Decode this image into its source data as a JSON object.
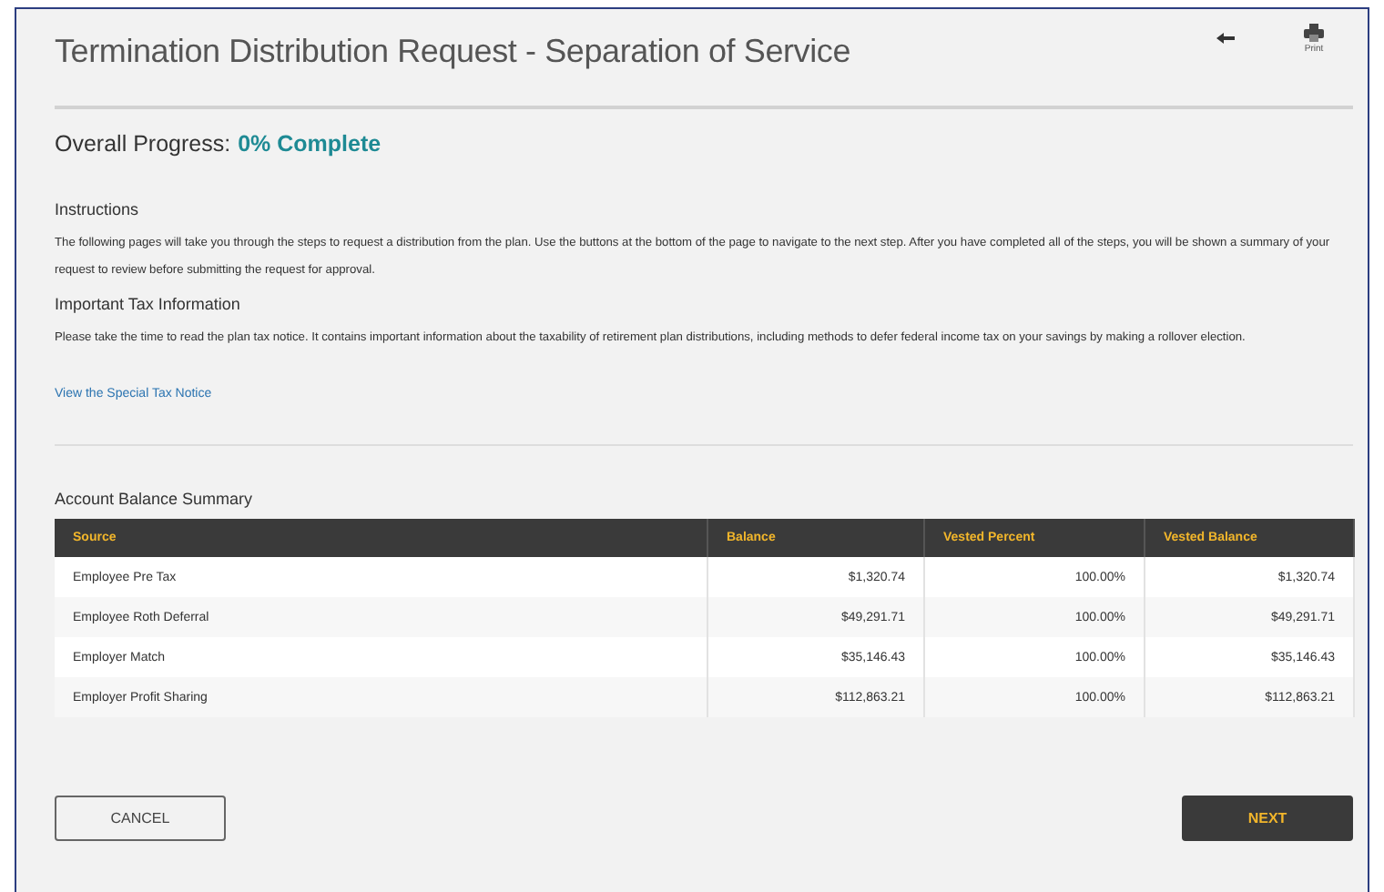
{
  "page": {
    "title": "Termination Distribution Request - Separation of Service",
    "print_label": "Print"
  },
  "progress": {
    "label": "Overall Progress:",
    "value": "0% Complete"
  },
  "instructions": {
    "heading": "Instructions",
    "text": "The following pages will take you through the steps to request a distribution from the plan. Use the buttons at the bottom of the page to navigate to the next step. After you have completed all of the steps, you will be shown a summary of your request to review before submitting the request for approval."
  },
  "tax_info": {
    "heading": "Important Tax Information",
    "text": "Please take the time to read the plan tax notice. It contains important information about the taxability of retirement plan distributions, including methods to defer federal income tax on your savings by making a rollover election.",
    "link": "View the Special Tax Notice"
  },
  "table": {
    "title": "Account Balance Summary",
    "columns": [
      "Source",
      "Balance",
      "Vested Percent",
      "Vested Balance"
    ],
    "rows": [
      [
        "Employee Pre Tax",
        "$1,320.74",
        "100.00%",
        "$1,320.74"
      ],
      [
        "Employee Roth Deferral",
        "$49,291.71",
        "100.00%",
        "$49,291.71"
      ],
      [
        "Employer Match",
        "$35,146.43",
        "100.00%",
        "$35,146.43"
      ],
      [
        "Employer Profit Sharing",
        "$112,863.21",
        "100.00%",
        "$112,863.21"
      ]
    ]
  },
  "buttons": {
    "cancel": "CANCEL",
    "next": "NEXT"
  }
}
